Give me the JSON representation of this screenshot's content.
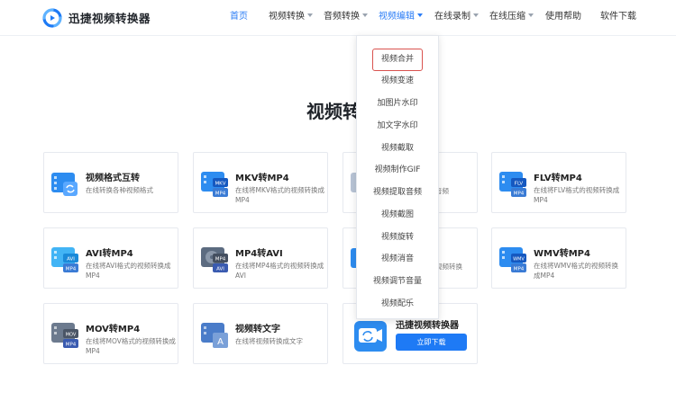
{
  "header": {
    "logo_text": "迅捷视频转换器",
    "nav": [
      {
        "label": "首页",
        "active": true,
        "has_caret": false
      },
      {
        "label": "视频转换",
        "active": false,
        "has_caret": true
      },
      {
        "label": "音频转换",
        "active": false,
        "has_caret": true
      },
      {
        "label": "视频编辑",
        "active": true,
        "has_caret": true
      },
      {
        "label": "在线录制",
        "active": false,
        "has_caret": true
      },
      {
        "label": "在线压缩",
        "active": false,
        "has_caret": true
      },
      {
        "label": "使用帮助",
        "active": false,
        "has_caret": false
      },
      {
        "label": "软件下载",
        "active": false,
        "has_caret": false
      }
    ]
  },
  "main": {
    "title": "视频转"
  },
  "cards": [
    {
      "title": "视频格式互转",
      "desc": "在线转换各种视频格式",
      "badge": "",
      "icon": "video-convert-icon"
    },
    {
      "title": "MKV转MP4",
      "desc": "在线将MKV格式的视频转换成MP4",
      "badge": "MKV",
      "icon": "mkv-to-mp4-icon"
    },
    {
      "title": "",
      "desc": "音频",
      "badge": "",
      "icon": "audio-icon"
    },
    {
      "title": "FLV转MP4",
      "desc": "在线将FLV格式的视频转换成MP4",
      "badge": "FLV",
      "icon": "flv-to-mp4-icon"
    },
    {
      "title": "AVI转MP4",
      "desc": "在线将AVI格式的视频转换成MP4",
      "badge": "AVI",
      "icon": "avi-to-mp4-icon"
    },
    {
      "title": "MP4转AVI",
      "desc": "在线将MP4格式的视频转换成AVI",
      "badge": "MP4",
      "icon": "mp4-to-avi-icon"
    },
    {
      "title": "",
      "desc": "视频转换",
      "badge": "",
      "icon": "video-icon"
    },
    {
      "title": "WMV转MP4",
      "desc": "在线将WMV格式的视频转换成MP4",
      "badge": "WMV",
      "icon": "wmv-to-mp4-icon"
    },
    {
      "title": "MOV转MP4",
      "desc": "在线将MOV格式的视频转换成MP4",
      "badge": "MOV",
      "icon": "mov-to-mp4-icon"
    },
    {
      "title": "视频转文字",
      "desc": "在线将视频转换成文字",
      "badge": "",
      "icon": "video-to-text-icon"
    }
  ],
  "promo": {
    "title": "迅捷视频转换器",
    "button": "立即下载"
  },
  "dropdown": {
    "items": [
      "视频合并",
      "视频变速",
      "加图片水印",
      "加文字水印",
      "视频截取",
      "视频制作GIF",
      "视频提取音频",
      "视频截图",
      "视频旋转",
      "视频消音",
      "视频调节音量",
      "视频配乐"
    ]
  },
  "colors": {
    "accent": "#2a7cf6",
    "highlight_border": "#d9534f",
    "button": "#1e7af5"
  }
}
